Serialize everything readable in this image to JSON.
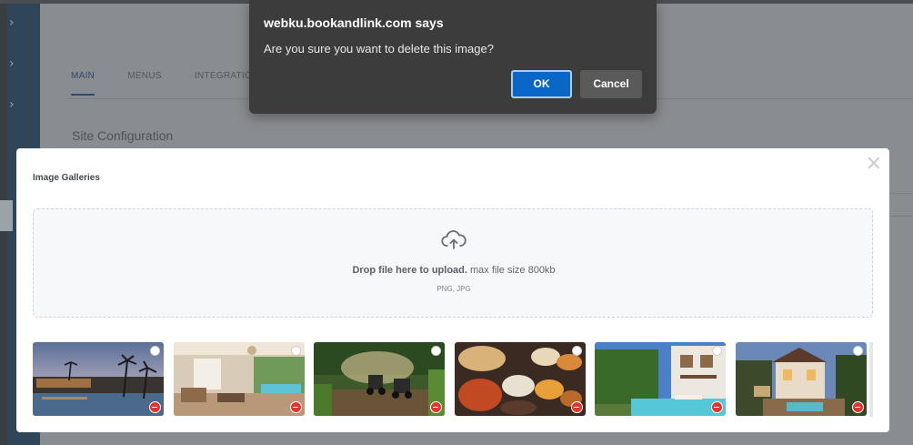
{
  "dialog": {
    "title": "webku.bookandlink.com says",
    "message": "Are you sure you want to delete this image?",
    "ok_label": "OK",
    "cancel_label": "Cancel"
  },
  "page": {
    "tabs": [
      {
        "label": "MAIN",
        "active": true
      },
      {
        "label": "MENUS",
        "active": false
      },
      {
        "label": "INTEGRATIC",
        "active": false
      }
    ],
    "section_title": "Site Configuration"
  },
  "sidebar": {
    "icons": [
      "chevron-right-icon",
      "chevron-right-icon",
      "chevron-right-icon"
    ]
  },
  "modal": {
    "title": "Image Galleries",
    "close_icon": "close-icon",
    "dropzone": {
      "icon": "cloud-upload-icon",
      "text_bold": "Drop file here to upload.",
      "text_rest": " max file size 800kb",
      "formats": "PNG, JPG"
    },
    "images": [
      {
        "scene": "resort-pool-dusk"
      },
      {
        "scene": "villa-living-room"
      },
      {
        "scene": "atv-jungle-ride"
      },
      {
        "scene": "indonesian-food-spread"
      },
      {
        "scene": "villa-pool-garden"
      },
      {
        "scene": "villa-courtyard-evening"
      }
    ]
  },
  "colors": {
    "ok_button": "#0a67c7",
    "delete_badge": "#e3342f",
    "dialog_bg": "#3c3c3c"
  }
}
